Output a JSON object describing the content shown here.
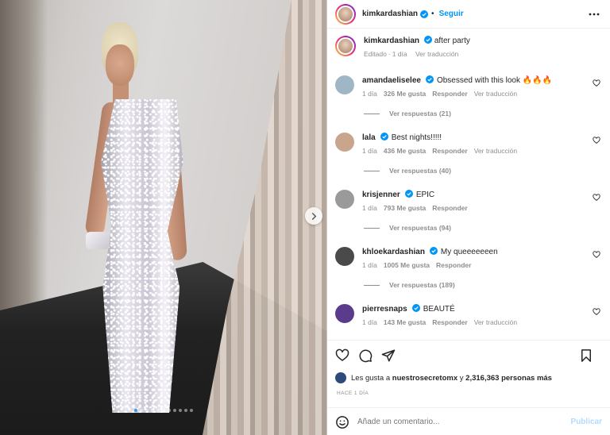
{
  "header": {
    "username": "kimkardashian",
    "separator": "•",
    "follow_label": "Seguir",
    "more_icon": "ellipsis-icon"
  },
  "caption": {
    "username": "kimkardashian",
    "text": "after party",
    "edited": "Editado",
    "dot": "·",
    "time": "1 día",
    "translate": "Ver traducción"
  },
  "comments": [
    {
      "username": "amandaeliselee",
      "text": "Obsessed with this look 🔥🔥🔥",
      "time": "1 día",
      "likes": "326 Me gusta",
      "reply": "Responder",
      "translate": "Ver traducción",
      "replies": "Ver respuestas (21)",
      "avatar_color": "#9fb6c6"
    },
    {
      "username": "lala",
      "text": "Best nights!!!!!",
      "time": "1 día",
      "likes": "436 Me gusta",
      "reply": "Responder",
      "translate": "Ver traducción",
      "replies": "Ver respuestas (40)",
      "avatar_color": "#c8a58c"
    },
    {
      "username": "krisjenner",
      "text": "EPIC",
      "time": "1 día",
      "likes": "793 Me gusta",
      "reply": "Responder",
      "translate": "",
      "replies": "Ver respuestas (94)",
      "avatar_color": "#9a9a9a"
    },
    {
      "username": "khloekardashian",
      "text": "My queeeeeeen",
      "time": "1 día",
      "likes": "1005 Me gusta",
      "reply": "Responder",
      "translate": "",
      "replies": "Ver respuestas (189)",
      "avatar_color": "#4a4a4a"
    },
    {
      "username": "pierresnaps",
      "text": "BEAUTÉ",
      "time": "1 día",
      "likes": "143 Me gusta",
      "reply": "Responder",
      "translate": "Ver traducción",
      "replies": "",
      "avatar_color": "#5b3b8c"
    }
  ],
  "likes": {
    "prefix": "Les gusta a",
    "user": "nuestrosecretomx",
    "middle": "y",
    "count": "2,316,363 personas más"
  },
  "time_ago": "HACE 1 DÍA",
  "add_comment": {
    "placeholder": "Añade un comentario...",
    "post_label": "Publicar"
  },
  "carousel": {
    "total": 11,
    "active": 1
  },
  "colors": {
    "verified": "#0095f6",
    "link": "#0095f6",
    "muted": "#8e8e8e"
  }
}
